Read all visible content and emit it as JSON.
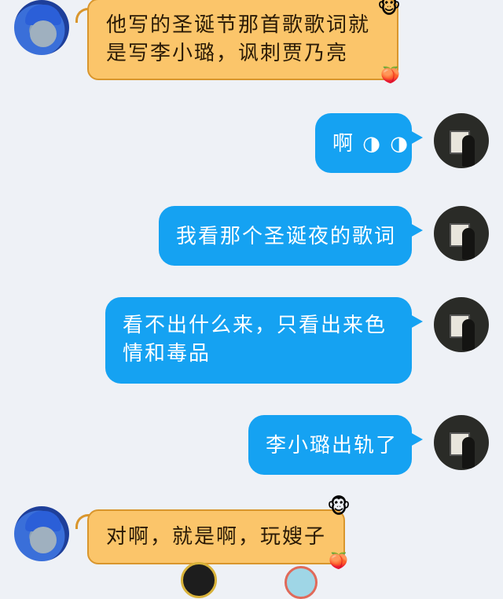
{
  "messages": [
    {
      "side": "left",
      "text_lines": [
        "他写的圣诞节那首歌歌词就",
        "是写李小璐，讽刺贾乃亮"
      ]
    },
    {
      "side": "right",
      "text": "啊 ◑ ◑"
    },
    {
      "side": "right",
      "text": "我看那个圣诞夜的歌词"
    },
    {
      "side": "right",
      "text_lines": [
        "看不出什么来，只看出来色",
        "情和毒品"
      ]
    },
    {
      "side": "right",
      "text": "李小璐出轨了"
    },
    {
      "side": "left",
      "text": "对啊，就是啊，玩嫂子"
    }
  ],
  "icons": {
    "left_avatar": "user-avatar-blue-cap",
    "right_avatar": "user-avatar-dark-silhouette",
    "bubble_top_deco": "monkey-face-icon",
    "bubble_bottom_deco": "peach-icon"
  },
  "colors": {
    "background": "#eef1f6",
    "orange_bubble": "#fbc56a",
    "orange_border": "#d9962d",
    "blue_bubble": "#15a2f2"
  }
}
